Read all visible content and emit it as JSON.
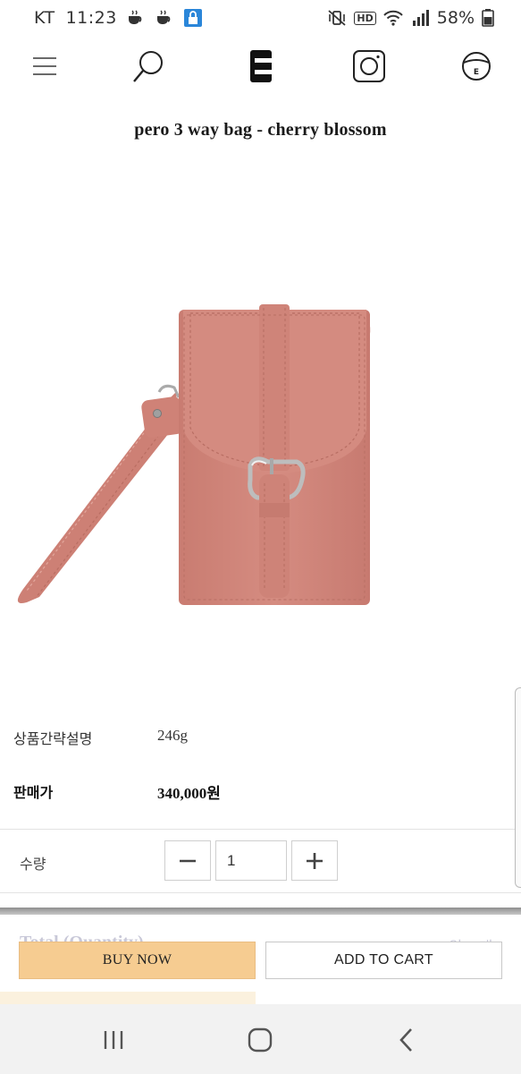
{
  "status_bar": {
    "carrier": "KT",
    "time": "11:23",
    "network": "HD",
    "battery": "58%"
  },
  "nav": {
    "menu_icon": "hamburger-icon",
    "search_icon": "search-icon",
    "logo_icon": "brand-logo-e",
    "instagram_icon": "instagram-icon",
    "account_icon": "profile-e-icon",
    "account_letter": "E"
  },
  "product": {
    "title": "pero 3 way bag - cherry blossom",
    "image_alt": "pink leather phone bag with buckle and wrist strap",
    "bag_color": "#d2877c"
  },
  "info": {
    "summary_label": "상품간략설명",
    "summary_value": "246g",
    "price_label": "판매가",
    "price_value": "340,000원"
  },
  "quantity": {
    "label": "수량",
    "value": "1",
    "minus_icon": "minus-icon",
    "plus_icon": "plus-icon"
  },
  "sticky": {
    "total_label": "Total (Quantity)",
    "total_value": "340,000원 (1개)",
    "buy_now": "BUY NOW",
    "add_to_cart": "ADD TO CART",
    "buy_color": "#f6cc91"
  },
  "android_nav": {
    "recents_icon": "recents-icon",
    "home_icon": "home-icon",
    "back_icon": "back-icon"
  }
}
